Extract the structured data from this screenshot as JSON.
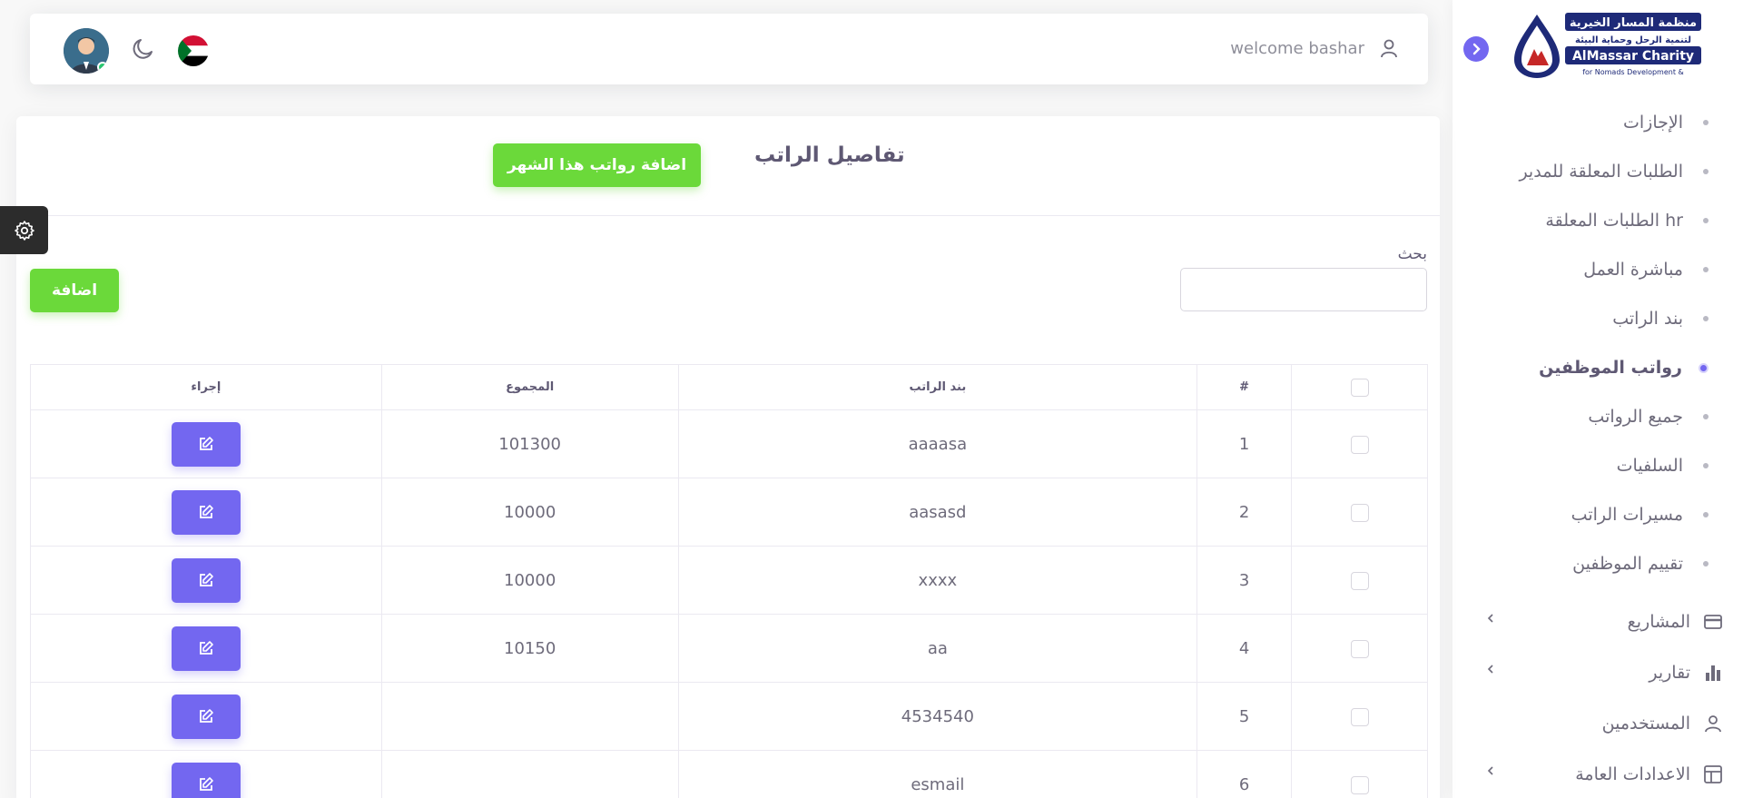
{
  "brand": {
    "arabic_name": "منظمة المسار الخيرية",
    "arabic_sub": "لتنمية الرحل وحماية البيئة",
    "english_name": "AlMassar Charity",
    "english_sub": "for Nomads Development &"
  },
  "sidebar": {
    "items": [
      {
        "label": "الإجازات"
      },
      {
        "label": "الطلبات المعلقة للمدير"
      },
      {
        "label": "الطلبات المعلقة hr"
      },
      {
        "label": "مباشرة العمل"
      },
      {
        "label": "بند الراتب"
      },
      {
        "label": "رواتب الموظفين",
        "active": true
      },
      {
        "label": "جميع الرواتب"
      },
      {
        "label": "السلفيات"
      },
      {
        "label": "مسيرات الراتب"
      },
      {
        "label": "تقييم الموظفين"
      }
    ],
    "groups": [
      {
        "label": "المشاريع",
        "icon": "credit-card-icon",
        "has_chevron": true
      },
      {
        "label": "تقارير",
        "icon": "bar-chart-icon",
        "has_chevron": true
      },
      {
        "label": "المستخدمين",
        "icon": "user-icon",
        "has_chevron": false
      },
      {
        "label": "الاعدادات العامة",
        "icon": "layout-icon",
        "has_chevron": true
      }
    ]
  },
  "navbar": {
    "welcome": "welcome bashar"
  },
  "card": {
    "title": "تفاصيل الراتب",
    "add_month_button": "اضافة رواتب هذا الشهر",
    "search_label": "بحث",
    "search_value": "",
    "add_button": "اضافة"
  },
  "table": {
    "headers": {
      "index": "#",
      "item": "بند الراتب",
      "total": "المجموع",
      "action": "إجراء"
    },
    "rows": [
      {
        "index": "1",
        "item": "aaaasa",
        "total": "101300"
      },
      {
        "index": "2",
        "item": "aasasd",
        "total": "10000"
      },
      {
        "index": "3",
        "item": "xxxx",
        "total": "10000"
      },
      {
        "index": "4",
        "item": "aa",
        "total": "10150"
      },
      {
        "index": "5",
        "item": "4534540",
        "total": ""
      },
      {
        "index": "6",
        "item": "esmail",
        "total": ""
      }
    ]
  },
  "colors": {
    "primary": "#7367f0",
    "success": "#6bd93a",
    "online": "#28c76f"
  }
}
